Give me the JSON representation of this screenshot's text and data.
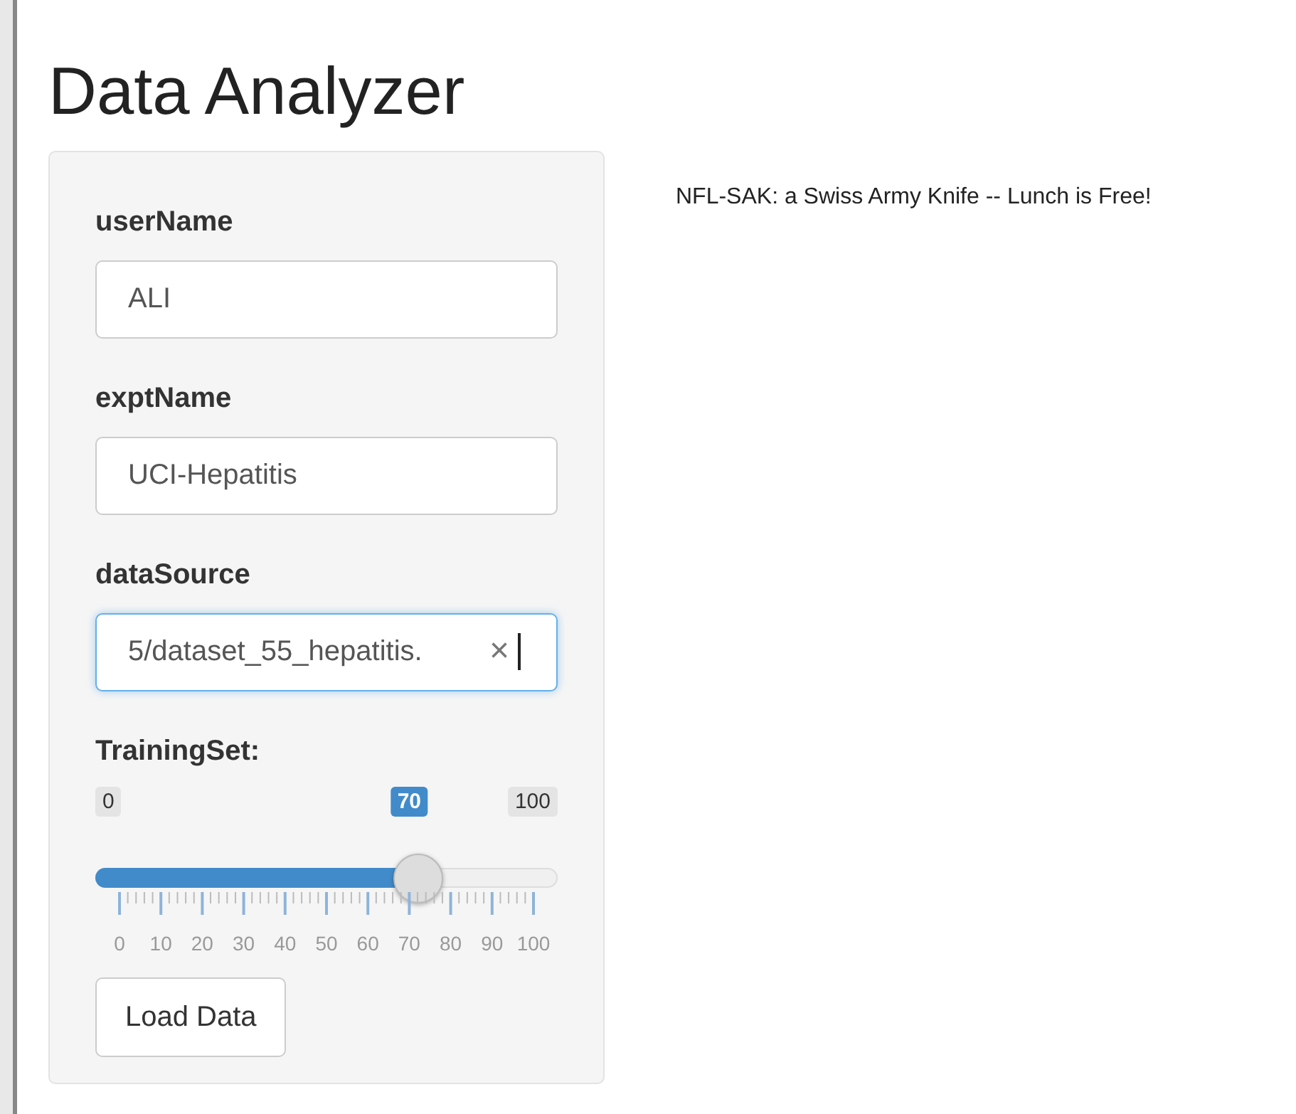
{
  "title": "Data Analyzer",
  "tagline": "NFL-SAK: a Swiss Army Knife -- Lunch is Free!",
  "fields": [
    {
      "label": "userName",
      "value": "ALI",
      "focused": false
    },
    {
      "label": "exptName",
      "value": "UCI-Hepatitis",
      "focused": false
    },
    {
      "label": "dataSource",
      "value": "5/dataset_55_hepatitis.",
      "focused": true,
      "clear_symbol": "×"
    }
  ],
  "slider": {
    "label": "TrainingSet:",
    "min": "0",
    "max": "100",
    "value": "70",
    "level": 0.7,
    "tick_labels": [
      "0",
      "10",
      "20",
      "30",
      "40",
      "50",
      "60",
      "70",
      "80",
      "90",
      "100"
    ]
  },
  "button": "Load Data"
}
